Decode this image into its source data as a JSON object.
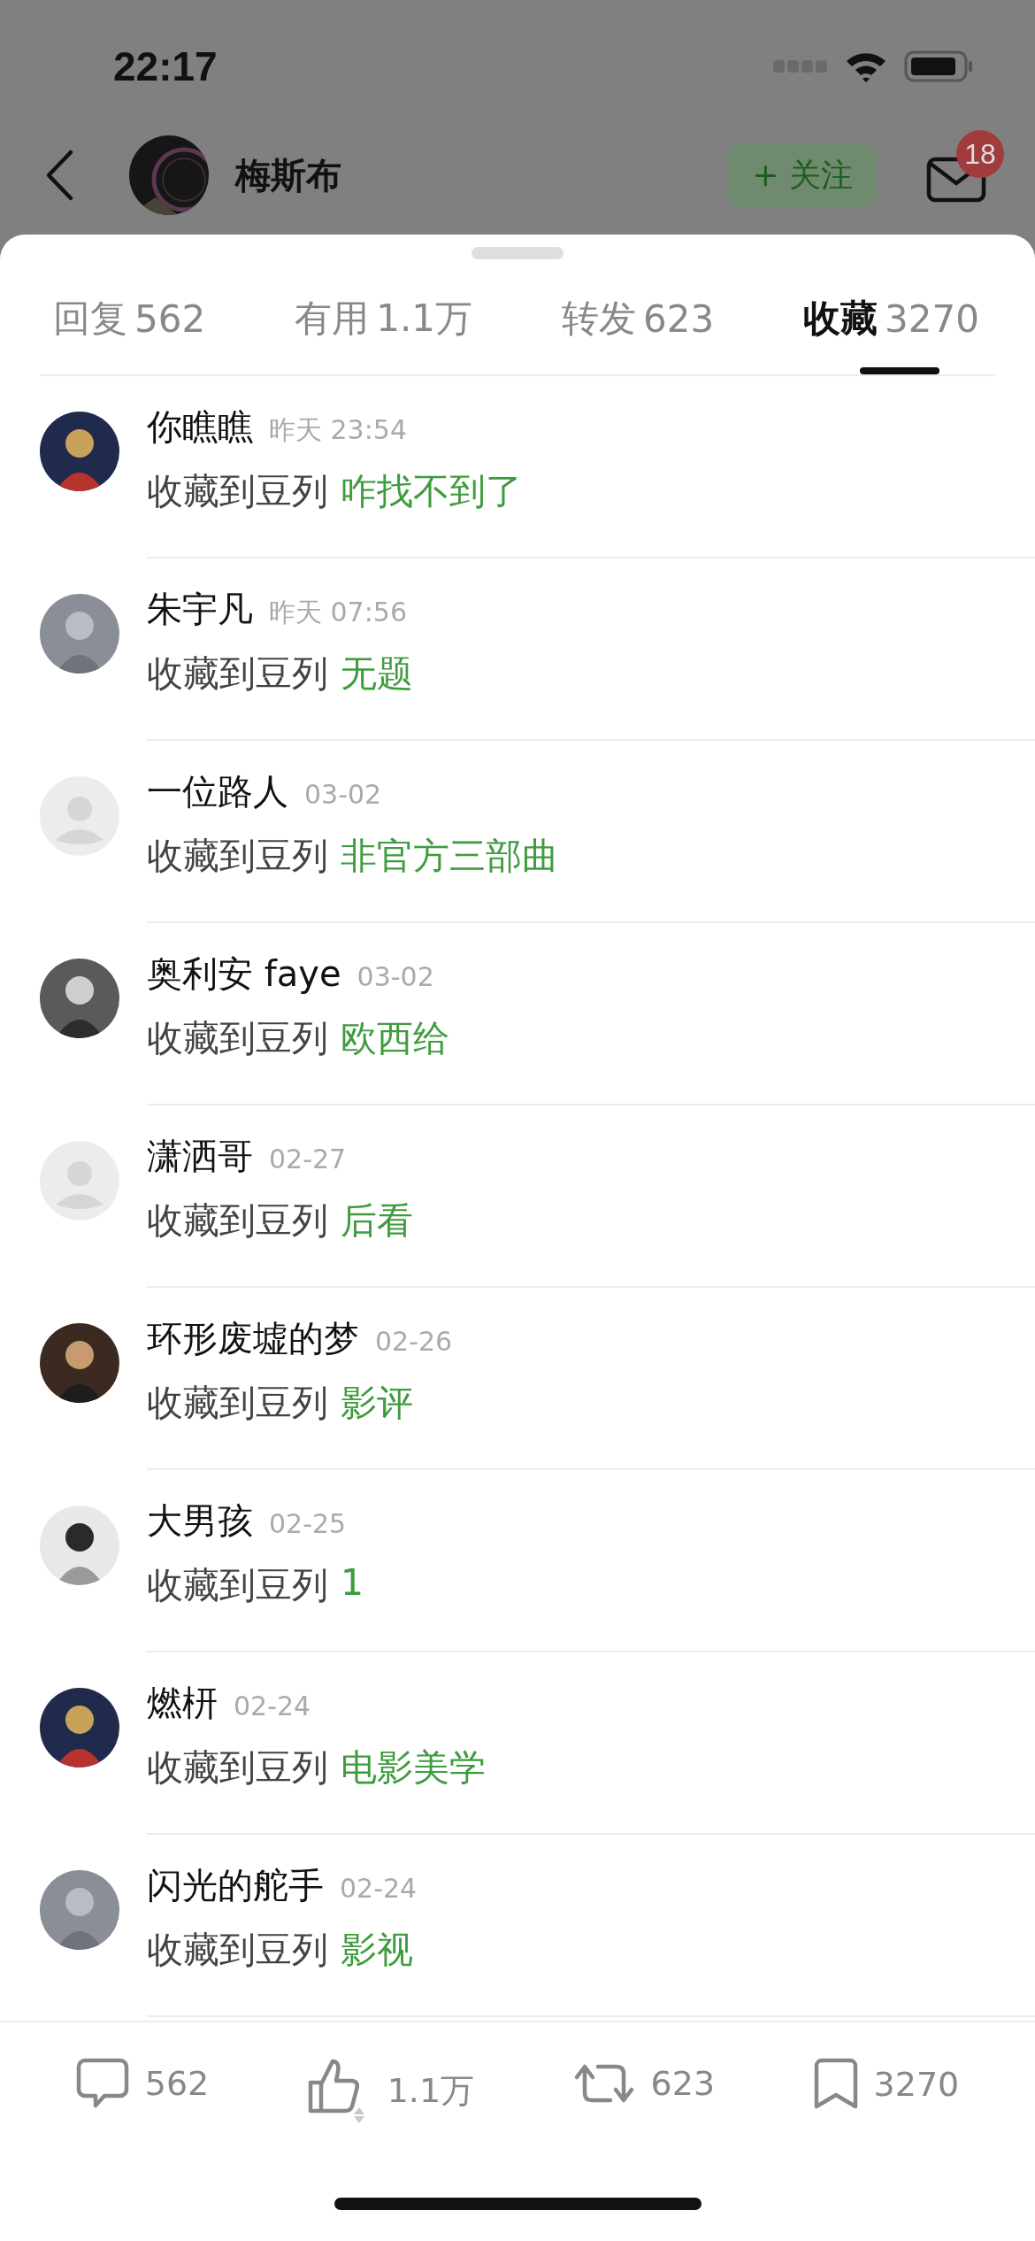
{
  "status_bar": {
    "time": "22:17"
  },
  "header": {
    "name": "梅斯布",
    "follow_button": "+ 关注",
    "mail_badge": "18"
  },
  "tabs": [
    {
      "label": "回复",
      "count": "562",
      "selected": false
    },
    {
      "label": "有用",
      "count": "1.1万",
      "selected": false
    },
    {
      "label": "转发",
      "count": "623",
      "selected": false
    },
    {
      "label": "收藏",
      "count": "3270",
      "selected": true
    }
  ],
  "items": [
    {
      "kind": "picture",
      "name": "你瞧瞧",
      "time": "昨天 23:54",
      "action": "收藏到豆列",
      "list": "咋找不到了"
    },
    {
      "kind": "picture",
      "name": "朱宇凡",
      "time": "昨天 07:56",
      "action": "收藏到豆列",
      "list": "无题"
    },
    {
      "kind": "default",
      "name": "一位路人",
      "time": "03-02",
      "action": "收藏到豆列",
      "list": "非官方三部曲"
    },
    {
      "kind": "picture",
      "name": "奥利安 faye",
      "time": "03-02",
      "action": "收藏到豆列",
      "list": "欧西给"
    },
    {
      "kind": "default",
      "name": "潇洒哥",
      "time": "02-27",
      "action": "收藏到豆列",
      "list": "后看"
    },
    {
      "kind": "picture",
      "name": "环形废墟的梦",
      "time": "02-26",
      "action": "收藏到豆列",
      "list": "影评"
    },
    {
      "kind": "picture",
      "name": "大男孩",
      "time": "02-25",
      "action": "收藏到豆列",
      "list": "1"
    },
    {
      "kind": "picture",
      "name": "燃枅",
      "time": "02-24",
      "action": "收藏到豆列",
      "list": "电影美学"
    },
    {
      "kind": "picture",
      "name": "闪光的舵手",
      "time": "02-24",
      "action": "收藏到豆列",
      "list": "影视"
    }
  ],
  "bottom_bar": [
    {
      "kind": "comment",
      "count": "562"
    },
    {
      "kind": "like",
      "count": "1.1万"
    },
    {
      "kind": "repost",
      "count": "623"
    },
    {
      "kind": "bookmark",
      "count": "3270"
    }
  ]
}
